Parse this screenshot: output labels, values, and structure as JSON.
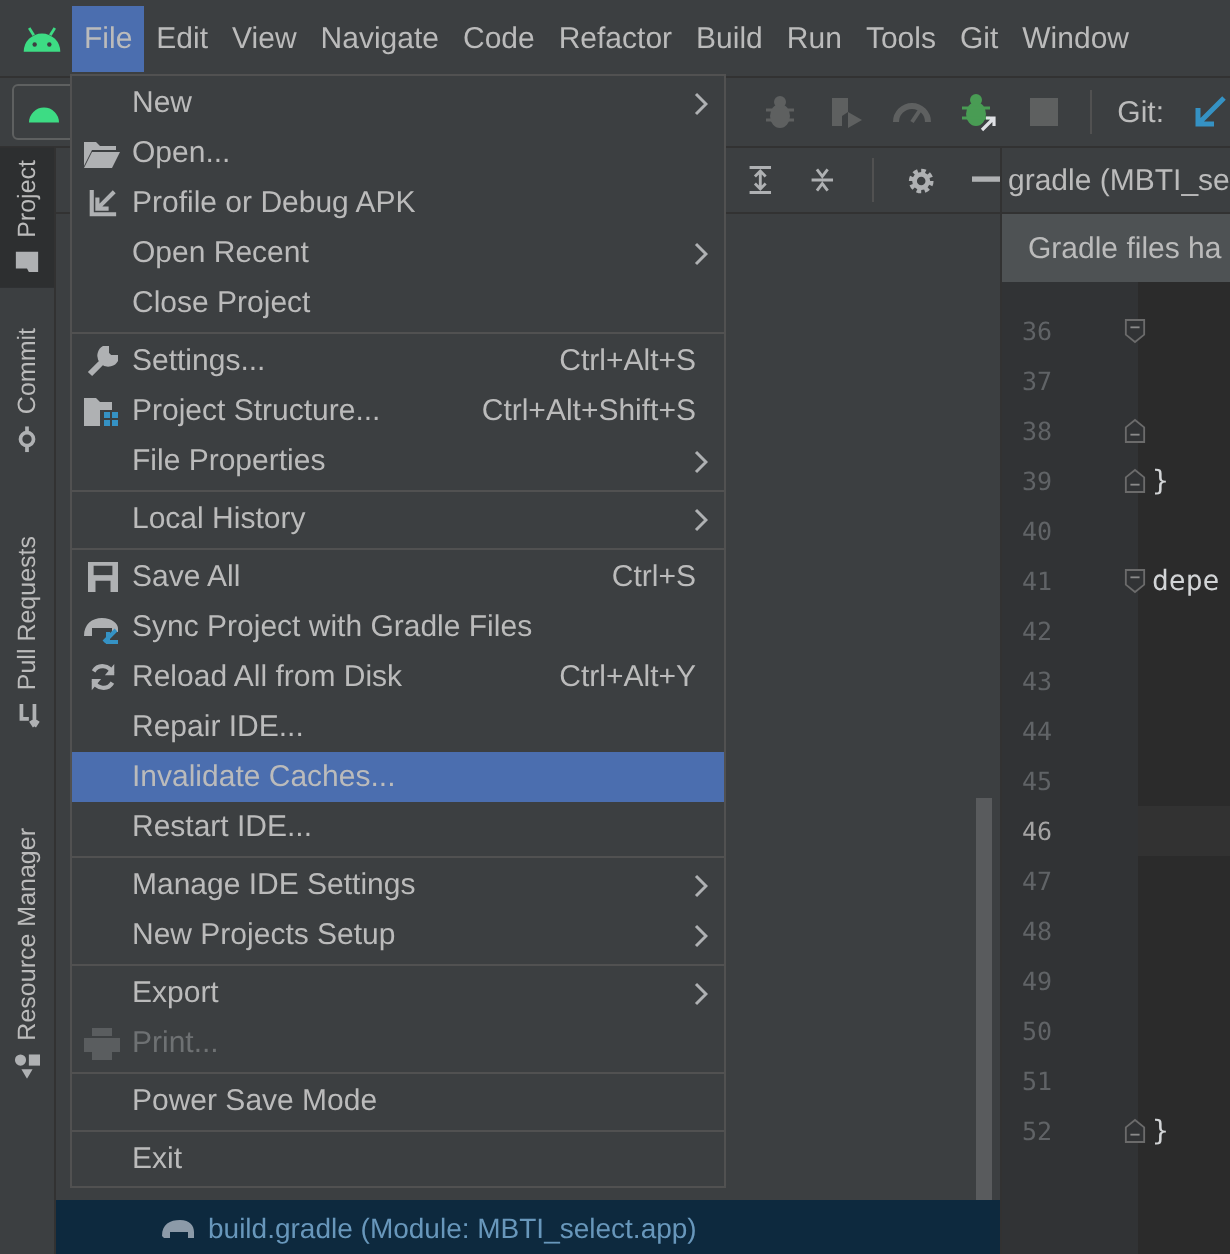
{
  "menu_bar": {
    "items": [
      {
        "label": "File",
        "selected": true
      },
      {
        "label": "Edit",
        "selected": false
      },
      {
        "label": "View",
        "selected": false
      },
      {
        "label": "Navigate",
        "selected": false
      },
      {
        "label": "Code",
        "selected": false
      },
      {
        "label": "Refactor",
        "selected": false
      },
      {
        "label": "Build",
        "selected": false
      },
      {
        "label": "Run",
        "selected": false
      },
      {
        "label": "Tools",
        "selected": false
      },
      {
        "label": "Git",
        "selected": false
      },
      {
        "label": "Window",
        "selected": false
      }
    ]
  },
  "toolbar": {
    "git_label": "Git:"
  },
  "tool_strip": {
    "tabs": [
      {
        "label": "Project",
        "selected": true
      },
      {
        "label": "Commit",
        "selected": false
      },
      {
        "label": "Pull Requests",
        "selected": false
      },
      {
        "label": "Resource Manager",
        "selected": false
      }
    ]
  },
  "project_panel": {
    "selected_row": "build.gradle (Module: MBTI_select.app)"
  },
  "editor": {
    "tab": "gradle (MBTI_se",
    "banner": "Gradle files ha",
    "lines": [
      {
        "number": "36",
        "kind": "fold-start",
        "current": false
      },
      {
        "number": "37",
        "kind": "plain",
        "current": false
      },
      {
        "number": "38",
        "kind": "fold-end",
        "current": false
      },
      {
        "number": "39",
        "code": "}",
        "kind": "fold-end",
        "current": false
      },
      {
        "number": "40",
        "kind": "plain",
        "current": false
      },
      {
        "number": "41",
        "code": "depe",
        "kind": "fold-start",
        "current": false
      },
      {
        "number": "42",
        "kind": "plain",
        "current": false
      },
      {
        "number": "43",
        "kind": "plain",
        "current": false
      },
      {
        "number": "44",
        "kind": "plain",
        "current": false
      },
      {
        "number": "45",
        "kind": "plain",
        "current": false
      },
      {
        "number": "46",
        "kind": "plain",
        "current": true
      },
      {
        "number": "47",
        "kind": "plain",
        "current": false
      },
      {
        "number": "48",
        "kind": "plain",
        "current": false
      },
      {
        "number": "49",
        "kind": "plain",
        "current": false
      },
      {
        "number": "50",
        "kind": "plain",
        "current": false
      },
      {
        "number": "51",
        "kind": "plain",
        "current": false
      },
      {
        "number": "52",
        "code": "}",
        "kind": "fold-end",
        "current": false
      }
    ]
  },
  "file_menu": {
    "groups": [
      [
        {
          "label": "New",
          "submenu": true,
          "selected": false,
          "disabled": false
        },
        {
          "label": "Open...",
          "submenu": false,
          "selected": false,
          "disabled": false
        },
        {
          "label": "Profile or Debug APK",
          "submenu": false,
          "selected": false,
          "disabled": false
        },
        {
          "label": "Open Recent",
          "submenu": true,
          "selected": false,
          "disabled": false
        },
        {
          "label": "Close Project",
          "submenu": false,
          "selected": false,
          "disabled": false
        }
      ],
      [
        {
          "label": "Settings...",
          "shortcut": "Ctrl+Alt+S",
          "submenu": false,
          "selected": false,
          "disabled": false
        },
        {
          "label": "Project Structure...",
          "shortcut": "Ctrl+Alt+Shift+S",
          "submenu": false,
          "selected": false,
          "disabled": false
        },
        {
          "label": "File Properties",
          "submenu": true,
          "selected": false,
          "disabled": false
        }
      ],
      [
        {
          "label": "Local History",
          "submenu": true,
          "selected": false,
          "disabled": false
        }
      ],
      [
        {
          "label": "Save All",
          "shortcut": "Ctrl+S",
          "submenu": false,
          "selected": false,
          "disabled": false
        },
        {
          "label": "Sync Project with Gradle Files",
          "submenu": false,
          "selected": false,
          "disabled": false
        },
        {
          "label": "Reload All from Disk",
          "shortcut": "Ctrl+Alt+Y",
          "submenu": false,
          "selected": false,
          "disabled": false
        },
        {
          "label": "Repair IDE...",
          "submenu": false,
          "selected": false,
          "disabled": false
        },
        {
          "label": "Invalidate Caches...",
          "submenu": false,
          "selected": true,
          "disabled": false
        },
        {
          "label": "Restart IDE...",
          "submenu": false,
          "selected": false,
          "disabled": false
        }
      ],
      [
        {
          "label": "Manage IDE Settings",
          "submenu": true,
          "selected": false,
          "disabled": false
        },
        {
          "label": "New Projects Setup",
          "submenu": true,
          "selected": false,
          "disabled": false
        }
      ],
      [
        {
          "label": "Export",
          "submenu": true,
          "selected": false,
          "disabled": false
        },
        {
          "label": "Print...",
          "submenu": false,
          "selected": false,
          "disabled": true
        }
      ],
      [
        {
          "label": "Power Save Mode",
          "submenu": false,
          "selected": false,
          "disabled": false
        }
      ],
      [
        {
          "label": "Exit",
          "submenu": false,
          "selected": false,
          "disabled": false
        }
      ]
    ]
  }
}
